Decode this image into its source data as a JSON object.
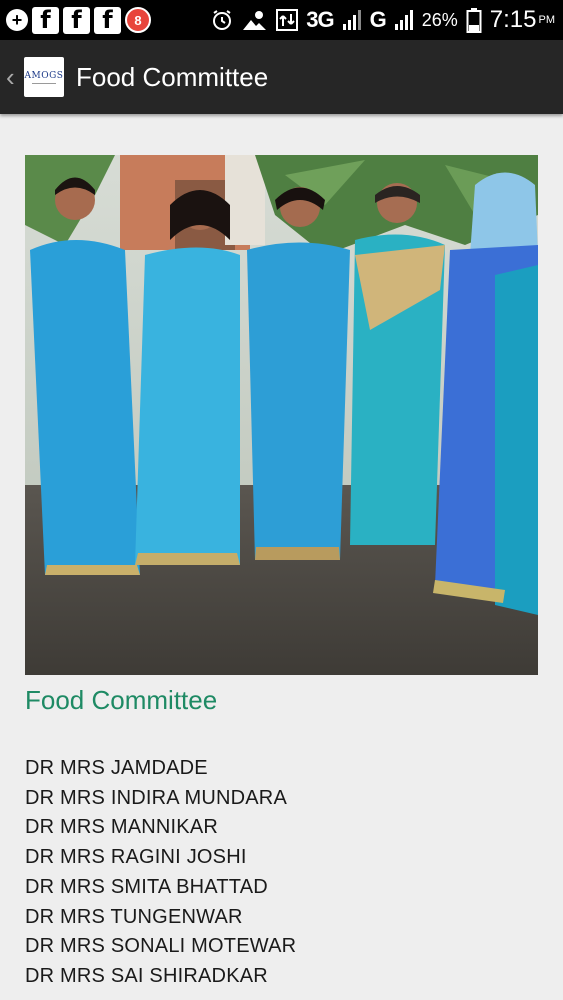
{
  "status_bar": {
    "network": "3G",
    "network2": "G",
    "battery": "26%",
    "time": "7:15",
    "ampm": "PM",
    "notification_count": "8",
    "icons": [
      "add-icon",
      "facebook-icon",
      "facebook-icon",
      "facebook-icon",
      "notification-badge",
      "alarm-icon",
      "weather-icon",
      "signal-icon",
      "battery-icon"
    ]
  },
  "action_bar": {
    "logo_text": "AMOGS",
    "title": "Food Committee"
  },
  "main": {
    "section_title": "Food Committee",
    "members": [
      "DR MRS JAMDADE",
      "DR MRS INDIRA MUNDARA",
      "DR MRS MANNIKAR",
      "DR MRS RAGINI JOSHI",
      "DR MRS SMITA BHATTAD",
      "DR MRS TUNGENWAR",
      "DR MRS SONALI MOTEWAR",
      "DR MRS SAI SHIRADKAR"
    ]
  },
  "colors": {
    "accent": "#1e8a64",
    "action_bar": "#262626",
    "background": "#eeeeee"
  }
}
